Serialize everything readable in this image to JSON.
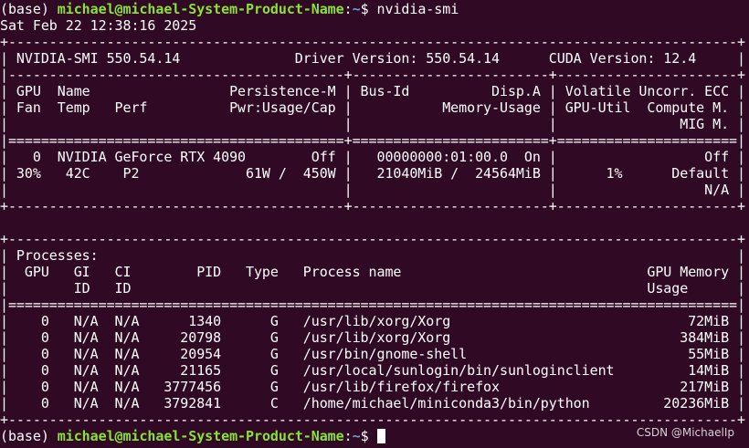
{
  "terminal": {
    "background": "#300a24",
    "prompt_user_color": "#8ae234",
    "prompt_path_color": "#729fcf",
    "prompt": {
      "env": "(base) ",
      "user_host": "michael@michael-System-Product-Name",
      "colon": ":",
      "path": "~",
      "symbol": "$ "
    },
    "command": "nvidia-smi",
    "output_lines": [
      "Sat Feb 22 12:38:16 2025",
      "+-----------------------------------------------------------------------------------------+",
      "| NVIDIA-SMI 550.54.14              Driver Version: 550.54.14      CUDA Version: 12.4     |",
      "|-----------------------------------------+------------------------+----------------------+",
      "| GPU  Name                 Persistence-M | Bus-Id          Disp.A | Volatile Uncorr. ECC |",
      "| Fan  Temp   Perf          Pwr:Usage/Cap |           Memory-Usage | GPU-Util  Compute M. |",
      "|                                         |                        |               MIG M. |",
      "|=========================================+========================+======================|",
      "|   0  NVIDIA GeForce RTX 4090        Off |   00000000:01:00.0  On |                  Off |",
      "| 30%   42C    P2             61W /  450W |   21040MiB /  24564MiB |      1%      Default |",
      "|                                         |                        |                  N/A |",
      "+-----------------------------------------+------------------------+----------------------+",
      "",
      "+-----------------------------------------------------------------------------------------+",
      "| Processes:                                                                              |",
      "|  GPU   GI   CI        PID   Type   Process name                              GPU Memory |",
      "|        ID   ID                                                               Usage      |",
      "|=========================================================================================|",
      "|    0   N/A  N/A      1340      G   /usr/lib/xorg/Xorg                             72MiB |",
      "|    0   N/A  N/A     20798      G   /usr/lib/xorg/Xorg                            384MiB |",
      "|    0   N/A  N/A     20954      G   /usr/bin/gnome-shell                           55MiB |",
      "|    0   N/A  N/A     21165      G   /usr/local/sunlogin/bin/sunloginclient         14MiB |",
      "|    0   N/A  N/A   3777456      G   /usr/lib/firefox/firefox                      217MiB |",
      "|    0   N/A  N/A   3792841      C   /home/michael/miniconda3/bin/python         20236MiB |",
      "+-----------------------------------------------------------------------------------------+"
    ]
  },
  "watermark": "CSDN @MichaelIp"
}
